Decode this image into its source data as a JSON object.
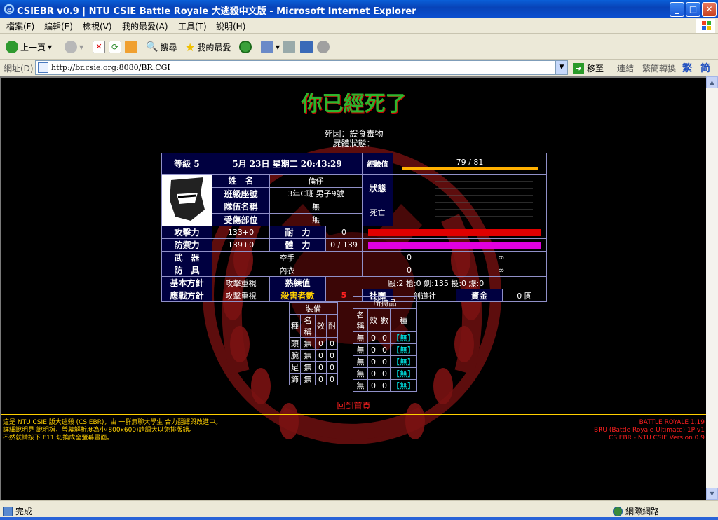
{
  "window": {
    "title": "CSIEBR v0.9 | NTU CSIE Battle Royale 大逃殺中文版 - Microsoft Internet Explorer",
    "min": "_",
    "max": "□",
    "close": "✕"
  },
  "menu": [
    "檔案(F)",
    "編輯(E)",
    "檢視(V)",
    "我的最愛(A)",
    "工具(T)",
    "說明(H)"
  ],
  "toolbar": {
    "back": "上一頁",
    "search": "搜尋",
    "favorites": "我的最愛"
  },
  "address": {
    "label": "網址(D)",
    "url": "http://br.csie.org:8080/BR.CGI",
    "go": "移至",
    "links": "連結",
    "convert": "繁簡轉換",
    "trad": "繁",
    "simp": "简"
  },
  "status": {
    "text": "完成",
    "zone": "網際網路"
  },
  "page": {
    "dead_title": "你已經死了",
    "cause_line": "死因：誤食毒物",
    "corpse_line": "屍體狀態：",
    "back_link": "回到首頁",
    "footer_left": [
      "這是 NTU CSIE 版大逃殺 (CSIEBR)，由 一群無聊大學生 合力翻譯與改進中。",
      "詳細說明見 說明檔，螢幕解析度為小(800x600)請調大以免排版錯。",
      "不然就請按下 F11 切換成全螢幕畫面。"
    ],
    "footer_right": [
      "BATTLE ROYALE 1.19",
      "BRU (Battle Royale Ultimate) 1P v1",
      "CSIEBR - NTU CSIE Version 0.9"
    ]
  },
  "stat": {
    "level": "等級 5",
    "date": "5月 23日 星期二 20:43:29",
    "exp_label": "經驗值",
    "exp_value": "79 / 81",
    "exp_ratio": 0.975,
    "name_label": "姓　名",
    "name": "倫仔",
    "class_label": "班級座號",
    "class": "3年C班 男子9號",
    "team_label": "隊伍名稱",
    "team": "無",
    "injury_label": "受傷部位",
    "injury": "無",
    "state_label": "狀態",
    "state": "死亡",
    "atk_label": "攻擊力",
    "atk": "133+0",
    "hp_label": "耐　力",
    "hp": "0",
    "hp_ratio": 1.0,
    "def_label": "防禦力",
    "def": "139+0",
    "sp_label": "體　力",
    "sp": "0 / 139",
    "sp_ratio": 1.0,
    "weapon_label": "武　器",
    "weapon": "空手",
    "weapon_a": "0",
    "weapon_b": "∞",
    "armor_label": "防　具",
    "armor": "內衣",
    "armor_a": "0",
    "armor_b": "∞",
    "policy_label": "基本方針",
    "policy": "攻擊重視",
    "skill_label": "熟練值",
    "skill": "毆:2 槍:0 劍:135 投:0 爆:0",
    "battle_label": "應戰方針",
    "battle": "攻擊重視",
    "kills_label": "殺害者數",
    "kills": "5",
    "club_label": "社團",
    "club": "劍道社",
    "money_label": "資金",
    "money": "0 圓"
  },
  "equip": {
    "title": "裝備",
    "headers": [
      "種",
      "名稱",
      "效",
      "耐"
    ],
    "rows": [
      [
        "頭",
        "無",
        "0",
        "0"
      ],
      [
        "腕",
        "無",
        "0",
        "0"
      ],
      [
        "足",
        "無",
        "0",
        "0"
      ],
      [
        "飾",
        "無",
        "0",
        "0"
      ]
    ]
  },
  "items": {
    "title": "所持品",
    "headers": [
      "名稱",
      "效",
      "數",
      "種"
    ],
    "rows": [
      [
        "無",
        "0",
        "0",
        "【無】"
      ],
      [
        "無",
        "0",
        "0",
        "【無】"
      ],
      [
        "無",
        "0",
        "0",
        "【無】"
      ],
      [
        "無",
        "0",
        "0",
        "【無】"
      ],
      [
        "無",
        "0",
        "0",
        "【無】"
      ]
    ]
  },
  "colors": {
    "exp_bar": "#ffb000",
    "hp_bar": "#e00000",
    "sp_bar": "#e000e0",
    "gold": "#ffd000"
  }
}
